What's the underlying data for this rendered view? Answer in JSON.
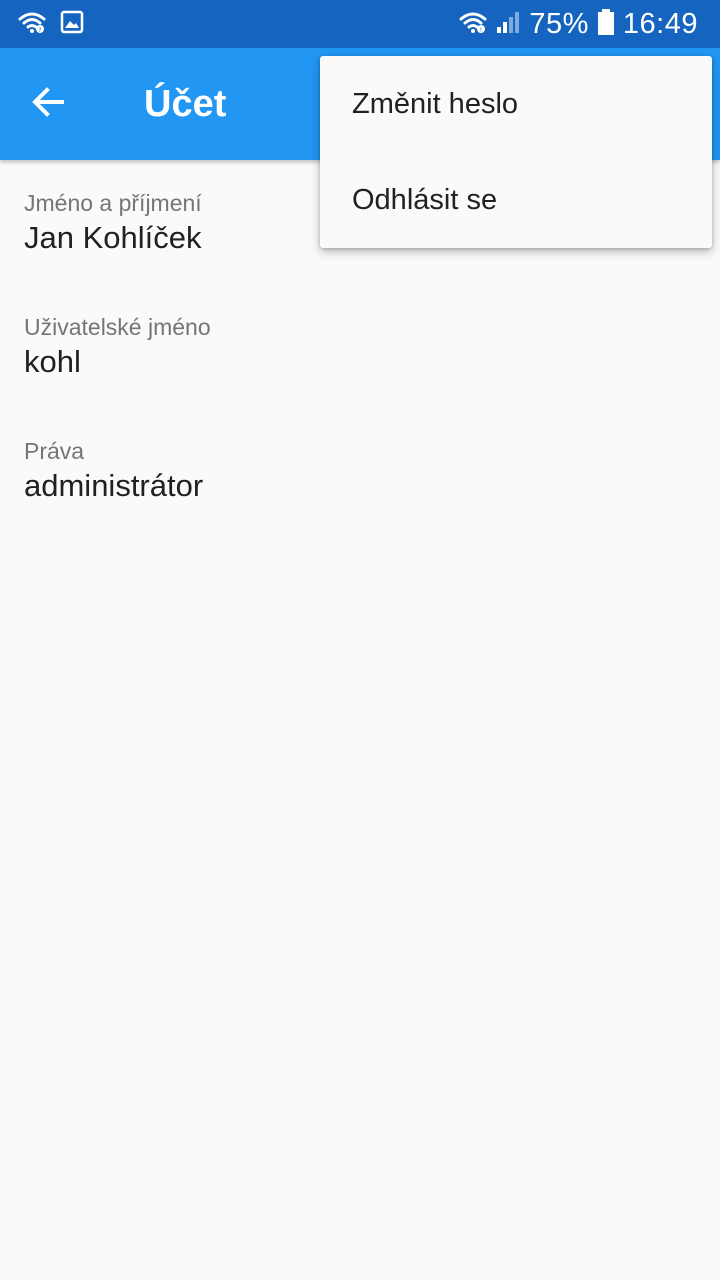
{
  "status_bar": {
    "battery_percent": "75%",
    "time": "16:49",
    "icons": [
      "wifi-icon",
      "gallery-icon",
      "wifi-icon",
      "signal-icon",
      "battery-icon"
    ]
  },
  "app_bar": {
    "title": "Účet",
    "back_icon": "arrow-left-icon"
  },
  "fields": [
    {
      "label": "Jméno a příjmení",
      "value": "Jan Kohlíček"
    },
    {
      "label": "Uživatelské jméno",
      "value": "kohl"
    },
    {
      "label": "Práva",
      "value": "administrátor"
    }
  ],
  "menu": {
    "items": [
      {
        "label": "Změnit heslo"
      },
      {
        "label": "Odhlásit se"
      }
    ]
  },
  "colors": {
    "status_bar": "#1565c0",
    "app_bar": "#2196f3",
    "background": "#fafafa"
  }
}
